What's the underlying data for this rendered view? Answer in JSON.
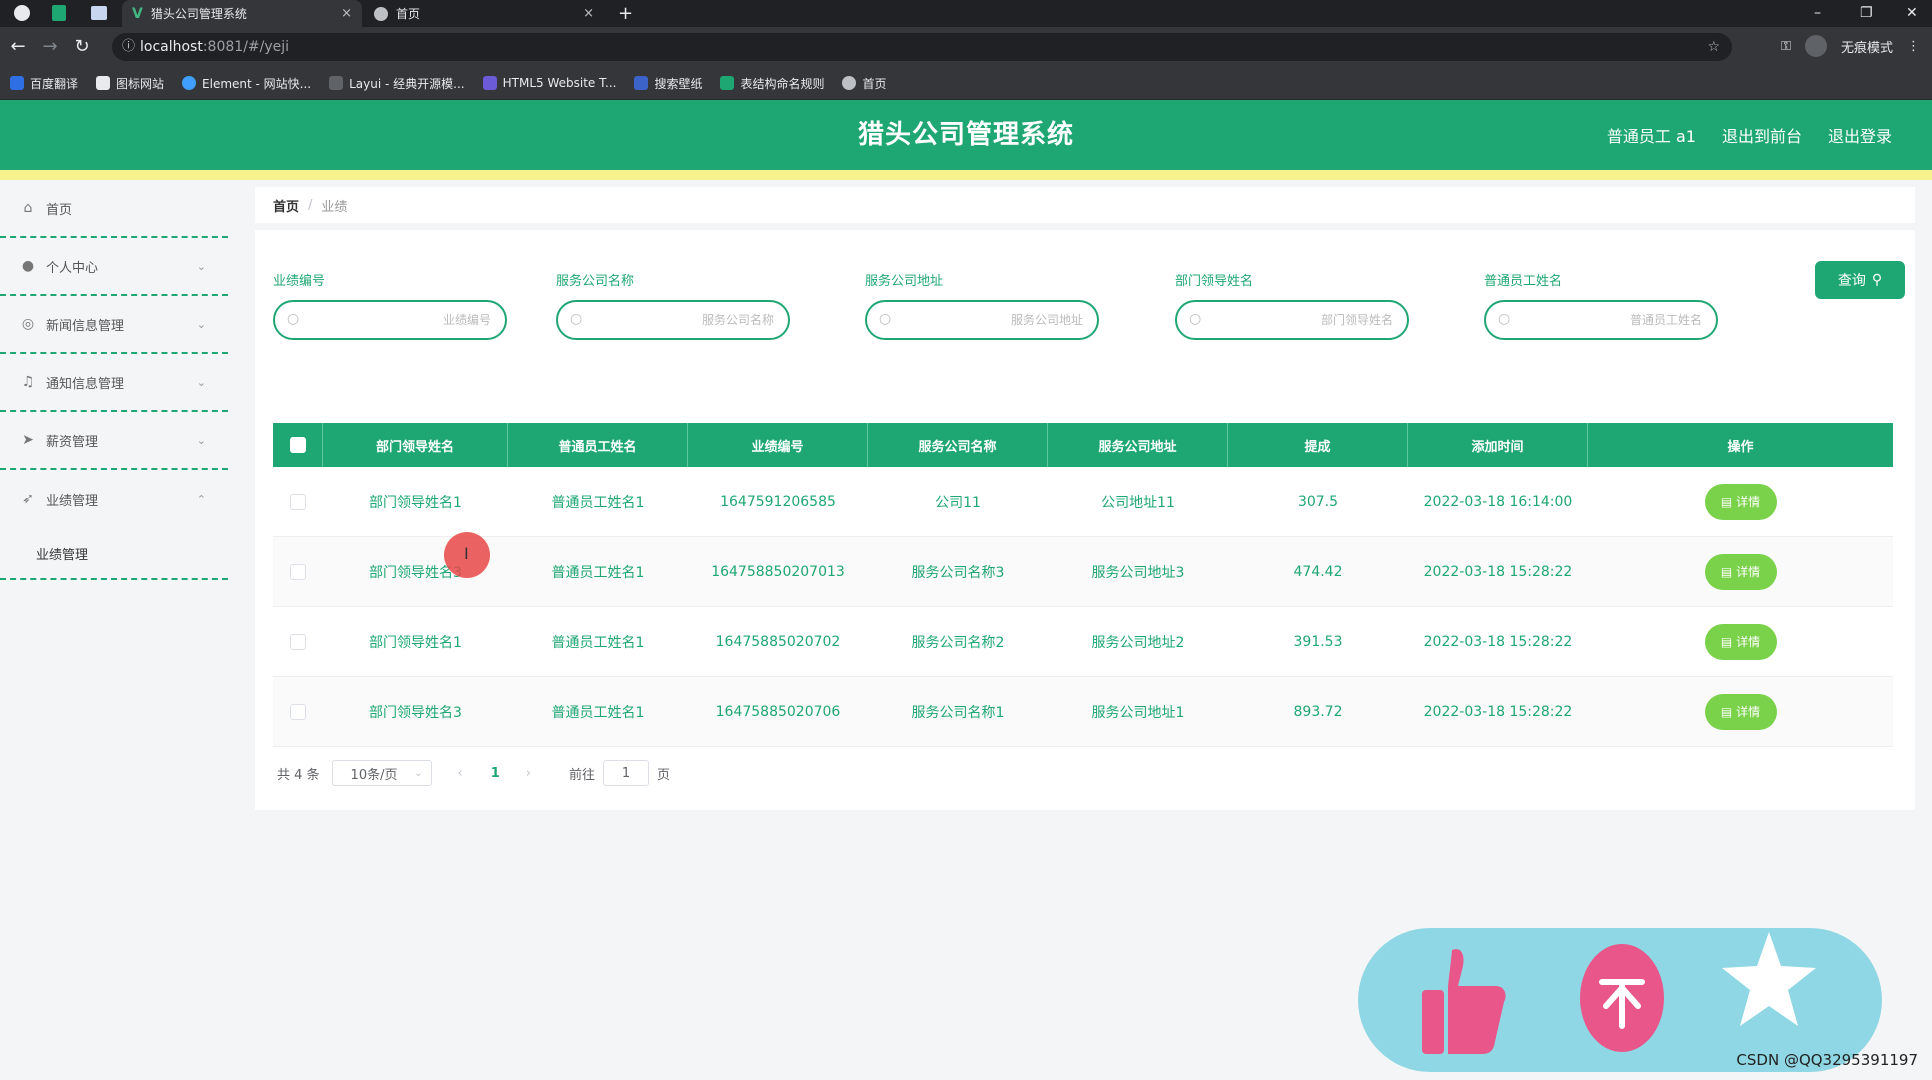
{
  "browser": {
    "tabs": [
      {
        "title": "猎头公司管理系统",
        "close": "×"
      },
      {
        "title": "首页",
        "close": "×"
      }
    ],
    "new_tab": "+",
    "url_host": "localhost",
    "url_rest": ":8081/#/yeji",
    "incognito_label": "无痕模式",
    "window_controls": {
      "minimize": "–",
      "restore": "❐",
      "close": "✕"
    },
    "bookmarks": [
      "百度翻译",
      "图标网站",
      "Element - 网站快...",
      "Layui - 经典开源模...",
      "HTML5 Website T...",
      "搜索壁纸",
      "表结构命名规则",
      "首页"
    ]
  },
  "header": {
    "title": "猎头公司管理系统",
    "user": "普通员工 a1",
    "back_front": "退出到前台",
    "logout": "退出登录"
  },
  "sidebar": {
    "items": [
      {
        "label": "首页",
        "icon": "home-icon",
        "expandable": false
      },
      {
        "label": "个人中心",
        "icon": "user-icon",
        "expandable": true
      },
      {
        "label": "新闻信息管理",
        "icon": "globe-icon",
        "expandable": true
      },
      {
        "label": "通知信息管理",
        "icon": "bell-icon",
        "expandable": true
      },
      {
        "label": "薪资管理",
        "icon": "send-icon",
        "expandable": true
      },
      {
        "label": "业绩管理",
        "icon": "location-arrow-icon",
        "expandable": true,
        "expanded": true
      }
    ],
    "subitem": "业绩管理"
  },
  "breadcrumb": {
    "home": "首页",
    "sep": "/",
    "current": "业绩"
  },
  "filters": [
    {
      "label": "业绩编号",
      "placeholder": "业绩编号"
    },
    {
      "label": "服务公司名称",
      "placeholder": "服务公司名称"
    },
    {
      "label": "服务公司地址",
      "placeholder": "服务公司地址"
    },
    {
      "label": "部门领导姓名",
      "placeholder": "部门领导姓名"
    },
    {
      "label": "普通员工姓名",
      "placeholder": "普通员工姓名"
    }
  ],
  "query_button": "查询",
  "table": {
    "columns": [
      "部门领导姓名",
      "普通员工姓名",
      "业绩编号",
      "服务公司名称",
      "服务公司地址",
      "提成",
      "添加时间",
      "操作"
    ],
    "rows": [
      [
        "部门领导姓名1",
        "普通员工姓名1",
        "1647591206585",
        "公司11",
        "公司地址11",
        "307.5",
        "2022-03-18 16:14:00"
      ],
      [
        "部门领导姓名3",
        "普通员工姓名1",
        "164758850207013",
        "服务公司名称3",
        "服务公司地址3",
        "474.42",
        "2022-03-18 15:28:22"
      ],
      [
        "部门领导姓名1",
        "普通员工姓名1",
        "16475885020702",
        "服务公司名称2",
        "服务公司地址2",
        "391.53",
        "2022-03-18 15:28:22"
      ],
      [
        "部门领导姓名3",
        "普通员工姓名1",
        "16475885020706",
        "服务公司名称1",
        "服务公司地址1",
        "893.72",
        "2022-03-18 15:28:22"
      ]
    ],
    "action_label": "详情"
  },
  "pagination": {
    "total": "共 4 条",
    "page_size": "10条/页",
    "current_page": "1",
    "goto_prefix": "前往",
    "goto_value": "1",
    "goto_suffix": "页"
  },
  "watermark": "CSDN @QQ3295391197",
  "colors": {
    "primary": "#1fa773",
    "accent_yellow": "#f6f28e",
    "detail_button": "#7ad14a",
    "float_bar": "#8fd7e4",
    "coin": "#e9578a"
  }
}
